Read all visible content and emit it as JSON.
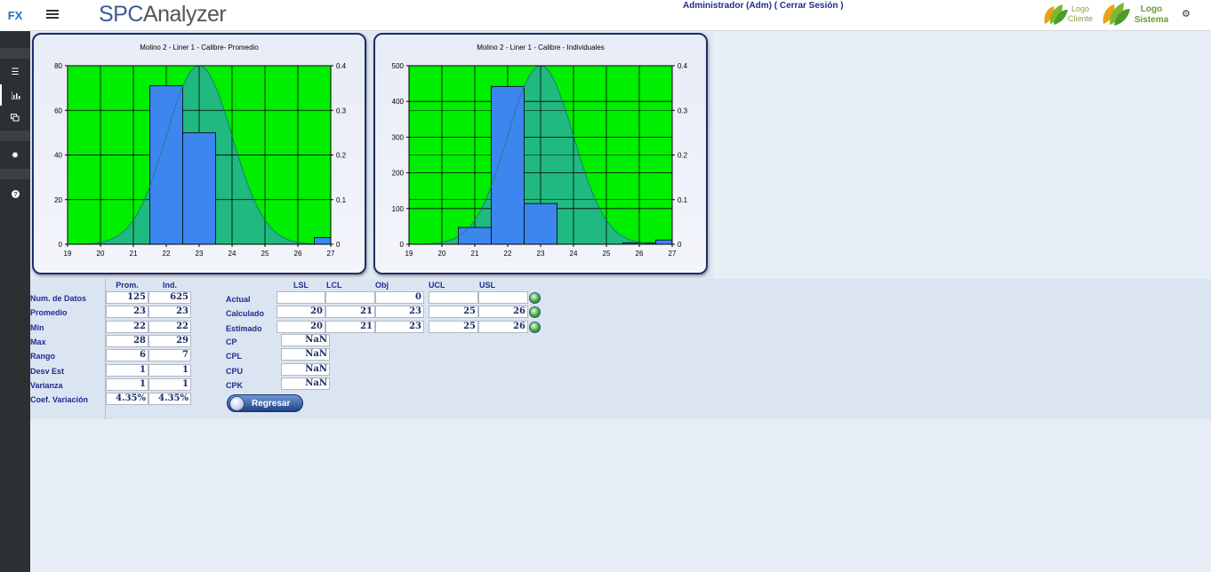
{
  "app": {
    "fx_label": "FX",
    "brand_part1": "SPC",
    "brand_part2": "Analyzer",
    "user_text": "Administrador (Adm) ( Cerrar Sesión )",
    "logo_client": [
      "Logo",
      "Cliente"
    ],
    "logo_system": [
      "Logo",
      "Sistema"
    ]
  },
  "sidebar": {
    "items": [
      {
        "icon": "menu-icon"
      },
      {
        "icon": "bar-chart-icon"
      },
      {
        "icon": "copy-icon"
      },
      {
        "icon": "gear-icon"
      },
      {
        "icon": "help-icon"
      }
    ]
  },
  "colors": {
    "plot_bg": "#00ee00",
    "bar": "#3d86f0",
    "curve": "#20b97f",
    "sidebar": "#2b3033",
    "title_blue": "#1e2d8f"
  },
  "chart_data": [
    {
      "type": "bar",
      "title": "Molino 2 - Liner 1 - Calibre- Promedio",
      "x_ticks": [
        19,
        20,
        21,
        22,
        23,
        24,
        25,
        26,
        27
      ],
      "y_ticks": [
        0,
        20,
        40,
        60,
        80
      ],
      "y2_ticks": [
        0,
        0.1,
        0.2,
        0.3,
        0.4
      ],
      "xlim": [
        19,
        27
      ],
      "ylim": [
        0,
        80
      ],
      "y2lim": [
        0,
        0.4
      ],
      "bars": [
        {
          "x0": 21.5,
          "x1": 22.5,
          "value": 71
        },
        {
          "x0": 22.5,
          "x1": 23.5,
          "value": 50
        },
        {
          "x0": 26.5,
          "x1": 27,
          "value": 3
        }
      ],
      "normal_curve": {
        "mean": 23,
        "sd": 1,
        "peak": 0.4
      },
      "grid": true
    },
    {
      "type": "bar",
      "title": "Molino 2 - Liner 1 - Calibre - Individuales",
      "x_ticks": [
        19,
        20,
        21,
        22,
        23,
        24,
        25,
        26,
        27
      ],
      "y_ticks": [
        0,
        100,
        200,
        300,
        400,
        500
      ],
      "y2_ticks": [
        0,
        0.1,
        0.2,
        0.3,
        0.4
      ],
      "xlim": [
        19,
        27
      ],
      "ylim": [
        0,
        500
      ],
      "y2lim": [
        0,
        0.4
      ],
      "bars": [
        {
          "x0": 20.5,
          "x1": 21.5,
          "value": 47
        },
        {
          "x0": 21.5,
          "x1": 22.5,
          "value": 442
        },
        {
          "x0": 22.5,
          "x1": 23.5,
          "value": 114
        },
        {
          "x0": 25.5,
          "x1": 26.5,
          "value": 4
        },
        {
          "x0": 26.5,
          "x1": 27,
          "value": 12
        }
      ],
      "normal_curve": {
        "mean": 23,
        "sd": 1,
        "peak": 0.4
      },
      "grid": true
    }
  ],
  "stats": {
    "col_headers": [
      "Prom.",
      "Ind."
    ],
    "rows": [
      {
        "label": "Num. de Datos",
        "prom": "125",
        "ind": "625"
      },
      {
        "label": "Promedio",
        "prom": "23",
        "ind": "23"
      },
      {
        "label": "Min",
        "prom": "22",
        "ind": "22"
      },
      {
        "label": "Max",
        "prom": "28",
        "ind": "29"
      },
      {
        "label": "Rango",
        "prom": "6",
        "ind": "7"
      },
      {
        "label": "Desv Est",
        "prom": "1",
        "ind": "1"
      },
      {
        "label": "Varianza",
        "prom": "1",
        "ind": "1"
      },
      {
        "label": "Coef. Variación",
        "prom": "4.35%",
        "ind": "4.35%"
      }
    ]
  },
  "limits": {
    "headers": [
      "LSL",
      "LCL",
      "Obj",
      "UCL",
      "USL"
    ],
    "rows": [
      {
        "label": "Actual",
        "values": [
          "",
          "",
          "0",
          "",
          ""
        ]
      },
      {
        "label": "Calculado",
        "values": [
          "20",
          "21",
          "23",
          "25",
          "26"
        ]
      },
      {
        "label": "Estimado",
        "values": [
          "20",
          "21",
          "23",
          "25",
          "26"
        ]
      }
    ]
  },
  "capability": [
    {
      "label": "CP",
      "value": "NaN"
    },
    {
      "label": "CPL",
      "value": "NaN"
    },
    {
      "label": "CPU",
      "value": "NaN"
    },
    {
      "label": "CPK",
      "value": "NaN"
    }
  ],
  "buttons": {
    "regresar": "Regresar"
  }
}
